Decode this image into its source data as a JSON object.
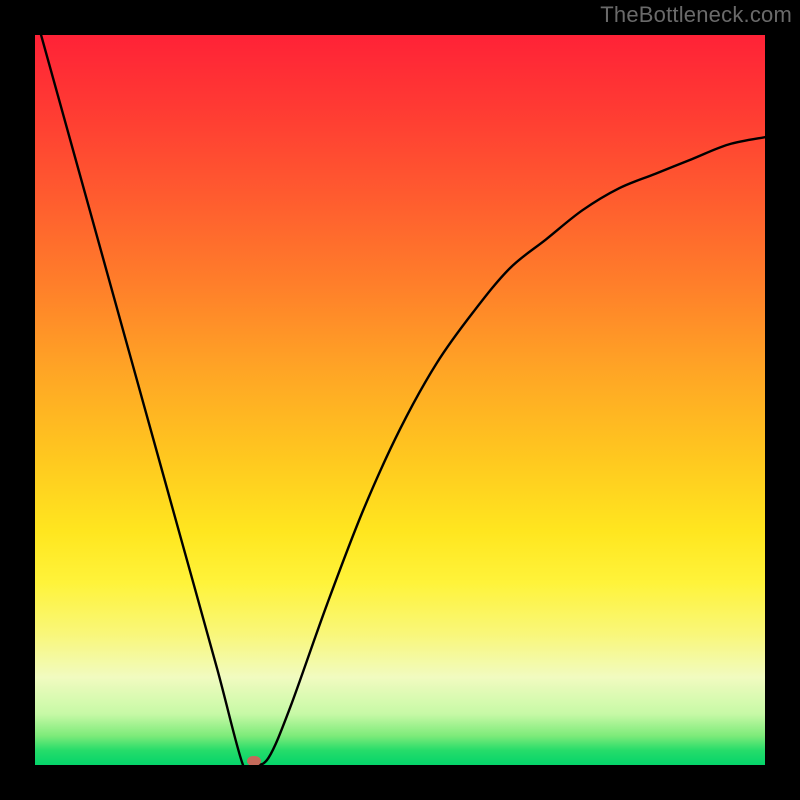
{
  "watermark": "TheBottleneck.com",
  "colors": {
    "frame_bg": "#000000",
    "watermark_text": "#6a6a6a",
    "curve_stroke": "#000000",
    "marker_fill": "#c46a5a"
  },
  "chart_data": {
    "type": "line",
    "title": "",
    "xlabel": "",
    "ylabel": "",
    "xlim": [
      0,
      1
    ],
    "ylim": [
      0,
      1
    ],
    "x": [
      0.0,
      0.05,
      0.1,
      0.15,
      0.2,
      0.25,
      0.285,
      0.3,
      0.32,
      0.35,
      0.4,
      0.45,
      0.5,
      0.55,
      0.6,
      0.65,
      0.7,
      0.75,
      0.8,
      0.85,
      0.9,
      0.95,
      1.0
    ],
    "values": [
      1.03,
      0.85,
      0.67,
      0.49,
      0.31,
      0.13,
      0.0,
      0.0,
      0.01,
      0.08,
      0.22,
      0.35,
      0.46,
      0.55,
      0.62,
      0.68,
      0.72,
      0.76,
      0.79,
      0.81,
      0.83,
      0.85,
      0.86
    ],
    "background_gradient_stops": [
      {
        "pos": 0.0,
        "color": "#ff2237"
      },
      {
        "pos": 0.1,
        "color": "#ff3a33"
      },
      {
        "pos": 0.22,
        "color": "#ff5b2f"
      },
      {
        "pos": 0.34,
        "color": "#ff7e2a"
      },
      {
        "pos": 0.46,
        "color": "#ffa525"
      },
      {
        "pos": 0.58,
        "color": "#ffc81f"
      },
      {
        "pos": 0.68,
        "color": "#ffe61f"
      },
      {
        "pos": 0.75,
        "color": "#fff33a"
      },
      {
        "pos": 0.82,
        "color": "#f9f779"
      },
      {
        "pos": 0.88,
        "color": "#f1fbc0"
      },
      {
        "pos": 0.93,
        "color": "#c7f9a6"
      },
      {
        "pos": 0.96,
        "color": "#7deb7a"
      },
      {
        "pos": 0.98,
        "color": "#26dc6a"
      },
      {
        "pos": 1.0,
        "color": "#04d46a"
      }
    ],
    "marker": {
      "x": 0.3,
      "y": 0.005
    },
    "notes": "V-shaped bottleneck curve; minimum near x≈0.30. Axes unlabeled; background encodes value via color gradient (red high → green low)."
  }
}
